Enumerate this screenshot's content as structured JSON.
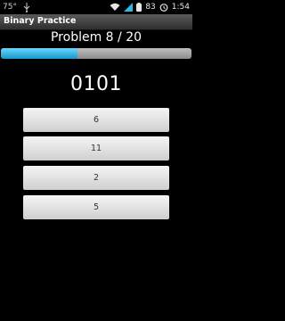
{
  "status_bar": {
    "temperature": "75°",
    "battery_level": "83",
    "time": "1:54"
  },
  "title_bar": {
    "title": "Binary Practice"
  },
  "problem": {
    "label": "Problem 8 / 20",
    "progress_fraction": 0.4
  },
  "question": {
    "binary": "0101"
  },
  "answers": [
    "6",
    "11",
    "2",
    "5"
  ],
  "colors": {
    "progress_fill": "#1896c8",
    "progress_track": "#a6a6a6"
  }
}
